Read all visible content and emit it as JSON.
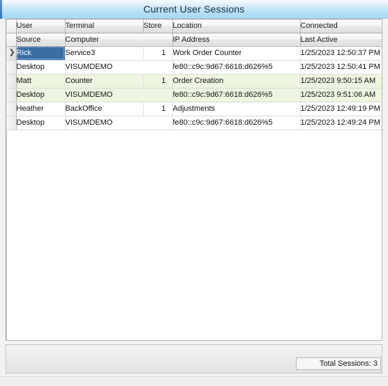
{
  "window": {
    "title": "Current User Sessions"
  },
  "grid": {
    "row_selector_icon": "row-selector-arrow-icon",
    "row_selector_glyph": "❯",
    "header_row_1": [
      {
        "key": "user",
        "label": "User"
      },
      {
        "key": "terminal",
        "label": "Terminal"
      },
      {
        "key": "store",
        "label": "Store"
      },
      {
        "key": "location",
        "label": "Location"
      },
      {
        "key": "connected",
        "label": "Connected"
      }
    ],
    "header_row_2": [
      {
        "key": "source",
        "label": "Source"
      },
      {
        "key": "computer",
        "label": "Computer"
      },
      {
        "key": "ip_address",
        "label": "IP Address"
      },
      {
        "key": "last_active",
        "label": "Last Active"
      }
    ],
    "rows": [
      {
        "selected": true,
        "band": "white",
        "primary": {
          "user": "Rick",
          "terminal": "Service3",
          "store": "1",
          "location": "Work Order Counter",
          "connected": "1/25/2023 12:50:37 PM"
        },
        "secondary": {
          "source": "Desktop",
          "computer": "VISUMDEMO",
          "ip_address": "fe80::c9c:9d67:6618:d626%5",
          "last_active": "1/25/2023 12:50:41 PM"
        }
      },
      {
        "selected": false,
        "band": "green",
        "primary": {
          "user": "Matt",
          "terminal": "Counter",
          "store": "1",
          "location": "Order Creation",
          "connected": "1/25/2023 9:50:15 AM"
        },
        "secondary": {
          "source": "Desktop",
          "computer": "VISUMDEMO",
          "ip_address": "fe80::c9c:9d67:6618:d626%5",
          "last_active": "1/25/2023 9:51:06 AM"
        }
      },
      {
        "selected": false,
        "band": "white",
        "primary": {
          "user": "Heather",
          "terminal": "BackOffice",
          "store": "1",
          "location": "Adjustments",
          "connected": "1/25/2023 12:49:19 PM"
        },
        "secondary": {
          "source": "Desktop",
          "computer": "VISUMDEMO",
          "ip_address": "fe80::c9c:9d67:6618:d626%5",
          "last_active": "1/25/2023 12:49:24 PM"
        }
      }
    ]
  },
  "footer": {
    "total_sessions_label": "Total Sessions: 3"
  },
  "colors": {
    "title_bar_top": "#f7fbfe",
    "title_bar_bottom": "#a7d8f5",
    "selection_blue": "#3a6ea5",
    "alt_row_green": "#eef5e0",
    "grid_border": "#9a9a9a"
  }
}
